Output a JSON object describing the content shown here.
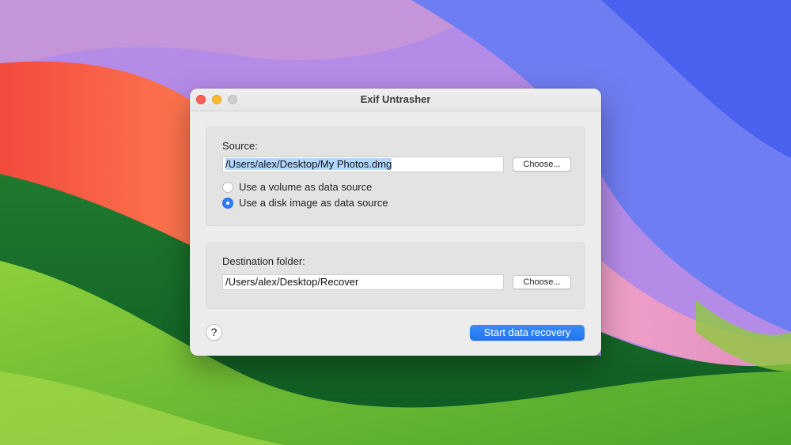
{
  "window": {
    "title": "Exif Untrasher"
  },
  "source": {
    "label": "Source:",
    "path_value": "/Users/alex/Desktop/My Photos.dmg",
    "choose_label": "Choose...",
    "options": [
      {
        "label": "Use a volume as data source",
        "selected": false
      },
      {
        "label": "Use a disk image as data source",
        "selected": true
      }
    ]
  },
  "destination": {
    "label": "Destination folder:",
    "path_value": "/Users/alex/Desktop/Recover",
    "choose_label": "Choose..."
  },
  "footer": {
    "help_label": "?",
    "start_label": "Start data recovery"
  },
  "colors": {
    "accent": "#2f7cf6",
    "close": "#fe5f57",
    "minimize": "#febc2e",
    "zoom_disabled": "#cfcfcf",
    "selection": "#b3d7ff"
  },
  "icons": {
    "close": "close-icon",
    "minimize": "minimize-icon",
    "zoom": "zoom-icon",
    "help": "help-icon"
  }
}
